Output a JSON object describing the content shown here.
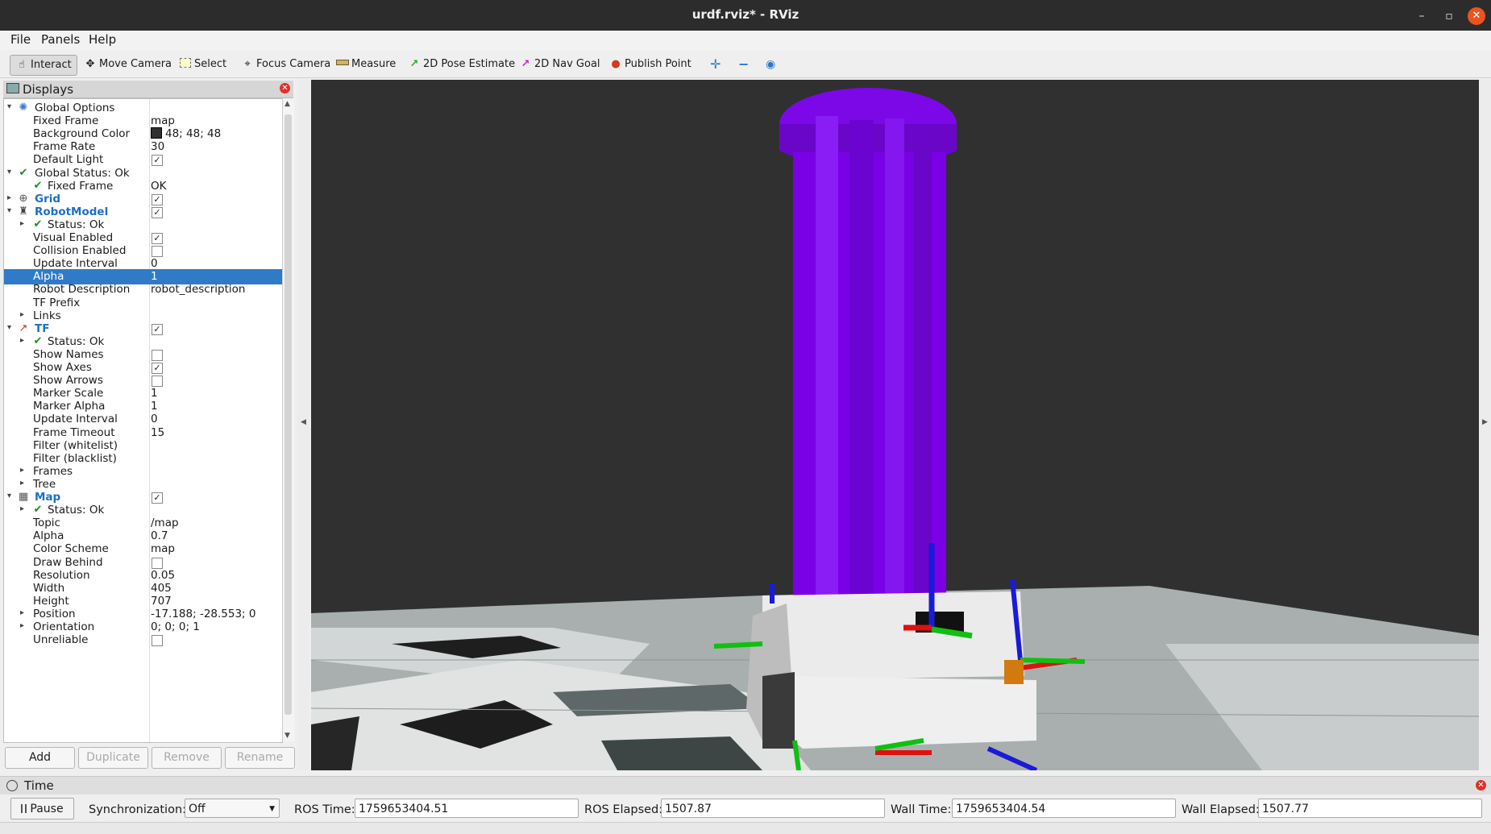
{
  "window": {
    "title": "urdf.rviz* - RViz"
  },
  "menu": {
    "file": "File",
    "panels": "Panels",
    "help": "Help"
  },
  "toolbar": {
    "interact": "Interact",
    "move_camera": "Move Camera",
    "select": "Select",
    "focus_camera": "Focus Camera",
    "measure": "Measure",
    "pose_estimate": "2D Pose Estimate",
    "nav_goal": "2D Nav Goal",
    "publish_point": "Publish Point"
  },
  "displays": {
    "title": "Displays",
    "rows": [
      {
        "name": "Global Options",
        "indent": 0,
        "arrow": "down",
        "icon": "globe-icon",
        "bold": false
      },
      {
        "name": "Fixed Frame",
        "value": "map",
        "indent": 1
      },
      {
        "name": "Background Color",
        "value": "48; 48; 48",
        "swatch": "#303030",
        "indent": 1
      },
      {
        "name": "Frame Rate",
        "value": "30",
        "indent": 1
      },
      {
        "name": "Default Light",
        "check": true,
        "indent": 1
      },
      {
        "name": "Global Status: Ok",
        "indent": 0,
        "arrow": "down",
        "icon": "check-icon"
      },
      {
        "name": "Fixed Frame",
        "value": "OK",
        "indent": 1,
        "icon": "check-icon"
      },
      {
        "name": "Grid",
        "indent": 0,
        "arrow": "right",
        "icon": "grid-icon",
        "bold": true,
        "check": true
      },
      {
        "name": "RobotModel",
        "indent": 0,
        "arrow": "down",
        "icon": "robot-icon",
        "bold": true,
        "check": true
      },
      {
        "name": "Status: Ok",
        "indent": 1,
        "arrow": "right",
        "icon": "check-icon"
      },
      {
        "name": "Visual Enabled",
        "check": true,
        "indent": 1
      },
      {
        "name": "Collision Enabled",
        "check": false,
        "indent": 1
      },
      {
        "name": "Update Interval",
        "value": "0",
        "indent": 1
      },
      {
        "name": "Alpha",
        "value": "1",
        "indent": 1,
        "selected": true
      },
      {
        "name": "Robot Description",
        "value": "robot_description",
        "indent": 1
      },
      {
        "name": "TF Prefix",
        "value": "",
        "indent": 1
      },
      {
        "name": "Links",
        "indent": 1,
        "arrow": "right"
      },
      {
        "name": "TF",
        "indent": 0,
        "arrow": "down",
        "icon": "axes-icon",
        "bold": true,
        "check": true
      },
      {
        "name": "Status: Ok",
        "indent": 1,
        "arrow": "right",
        "icon": "check-icon"
      },
      {
        "name": "Show Names",
        "check": false,
        "indent": 1
      },
      {
        "name": "Show Axes",
        "check": true,
        "indent": 1
      },
      {
        "name": "Show Arrows",
        "check": false,
        "indent": 1
      },
      {
        "name": "Marker Scale",
        "value": "1",
        "indent": 1
      },
      {
        "name": "Marker Alpha",
        "value": "1",
        "indent": 1
      },
      {
        "name": "Update Interval",
        "value": "0",
        "indent": 1
      },
      {
        "name": "Frame Timeout",
        "value": "15",
        "indent": 1
      },
      {
        "name": "Filter (whitelist)",
        "value": "",
        "indent": 1
      },
      {
        "name": "Filter (blacklist)",
        "value": "",
        "indent": 1
      },
      {
        "name": "Frames",
        "indent": 1,
        "arrow": "right"
      },
      {
        "name": "Tree",
        "indent": 1,
        "arrow": "right"
      },
      {
        "name": "Map",
        "indent": 0,
        "arrow": "down",
        "icon": "map-icon",
        "bold": true,
        "check": true
      },
      {
        "name": "Status: Ok",
        "indent": 1,
        "arrow": "right",
        "icon": "check-icon"
      },
      {
        "name": "Topic",
        "value": "/map",
        "indent": 1
      },
      {
        "name": "Alpha",
        "value": "0.7",
        "indent": 1
      },
      {
        "name": "Color Scheme",
        "value": "map",
        "indent": 1
      },
      {
        "name": "Draw Behind",
        "check": false,
        "indent": 1
      },
      {
        "name": "Resolution",
        "value": "0.05",
        "indent": 1
      },
      {
        "name": "Width",
        "value": "405",
        "indent": 1
      },
      {
        "name": "Height",
        "value": "707",
        "indent": 1
      },
      {
        "name": "Position",
        "value": "-17.188; -28.553; 0",
        "indent": 1,
        "arrow": "right"
      },
      {
        "name": "Orientation",
        "value": "0; 0; 0; 1",
        "indent": 1,
        "arrow": "right"
      },
      {
        "name": "Unreliable",
        "check": false,
        "indent": 1
      }
    ],
    "buttons": {
      "add": "Add",
      "duplicate": "Duplicate",
      "remove": "Remove",
      "rename": "Rename"
    }
  },
  "time": {
    "title": "Time",
    "pause": "Pause",
    "sync_label": "Synchronization:",
    "sync_value": "Off",
    "ros_time_label": "ROS Time:",
    "ros_time": "1759653404.51",
    "ros_elapsed_label": "ROS Elapsed:",
    "ros_elapsed": "1507.87",
    "wall_time_label": "Wall Time:",
    "wall_time": "1759653404.54",
    "wall_elapsed_label": "Wall Elapsed:",
    "wall_elapsed": "1507.77"
  },
  "colors": {
    "background": "#303030",
    "robot_column": "#7a00e6",
    "selection": "#2f7bc8",
    "close_button": "#e95420"
  }
}
